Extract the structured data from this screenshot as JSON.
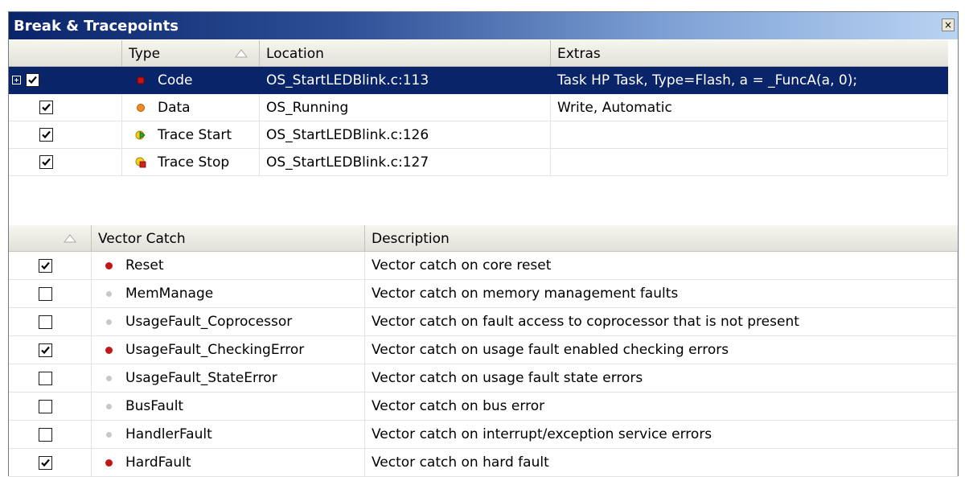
{
  "window": {
    "title": "Break & Tracepoints",
    "close_glyph": "×"
  },
  "breakpoints": {
    "columns": {
      "type": "Type",
      "location": "Location",
      "extras": "Extras"
    },
    "rows": [
      {
        "enabled": true,
        "type": "Code",
        "icon": "code-breakpoint-icon",
        "location": "OS_StartLEDBlink.c:113",
        "extras": "Task HP Task, Type=Flash, a = _FuncA(a, 0);",
        "selected": true,
        "expandable": true
      },
      {
        "enabled": true,
        "type": "Data",
        "icon": "data-breakpoint-icon",
        "location": "OS_Running",
        "extras": "Write, Automatic",
        "selected": false,
        "expandable": false
      },
      {
        "enabled": true,
        "type": "Trace Start",
        "icon": "trace-start-icon",
        "location": "OS_StartLEDBlink.c:126",
        "extras": "",
        "selected": false,
        "expandable": false
      },
      {
        "enabled": true,
        "type": "Trace Stop",
        "icon": "trace-stop-icon",
        "location": "OS_StartLEDBlink.c:127",
        "extras": "",
        "selected": false,
        "expandable": false
      }
    ]
  },
  "vector_catch": {
    "columns": {
      "vector": "Vector Catch",
      "description": "Description"
    },
    "rows": [
      {
        "enabled": true,
        "name": "Reset",
        "description": "Vector catch on core reset"
      },
      {
        "enabled": false,
        "name": "MemManage",
        "description": "Vector catch on memory management faults"
      },
      {
        "enabled": false,
        "name": "UsageFault_Coprocessor",
        "description": "Vector catch on fault access to coprocessor that is not present"
      },
      {
        "enabled": true,
        "name": "UsageFault_CheckingError",
        "description": "Vector catch on usage fault enabled checking errors"
      },
      {
        "enabled": false,
        "name": "UsageFault_StateError",
        "description": "Vector catch on usage fault state errors"
      },
      {
        "enabled": false,
        "name": "BusFault",
        "description": "Vector catch on bus error"
      },
      {
        "enabled": false,
        "name": "HandlerFault",
        "description": "Vector catch on interrupt/exception service errors"
      },
      {
        "enabled": true,
        "name": "HardFault",
        "description": "Vector catch on hard fault"
      }
    ]
  },
  "colors": {
    "selection": "#0a246a",
    "enabled_dot": "#c01818",
    "disabled_dot": "#c8c8c8"
  }
}
